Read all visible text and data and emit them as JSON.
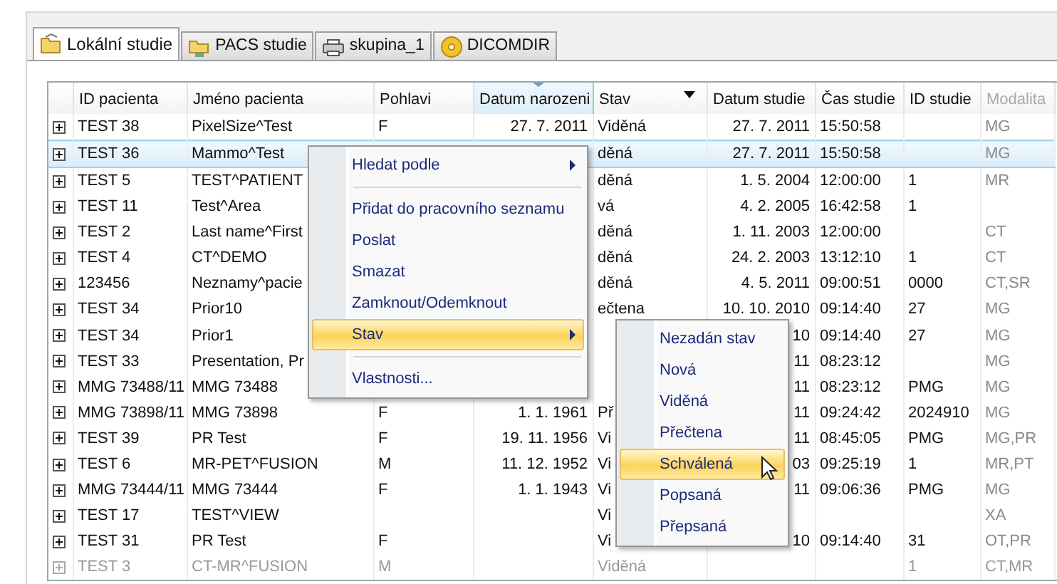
{
  "tabs": [
    {
      "label": "Lokální studie",
      "selected": true,
      "kind": "folder"
    },
    {
      "label": "PACS studie",
      "selected": false,
      "kind": "network"
    },
    {
      "label": "skupina_1",
      "selected": false,
      "kind": "printer"
    },
    {
      "label": "DICOMDIR",
      "selected": false,
      "kind": "disc"
    }
  ],
  "table": {
    "columns": [
      {
        "label": "ID pacienta",
        "sorted": false,
        "filter": false,
        "dimmed": false
      },
      {
        "label": "Jméno pacienta",
        "sorted": false,
        "filter": false,
        "dimmed": false
      },
      {
        "label": "Pohlavi",
        "sorted": false,
        "filter": false,
        "dimmed": false
      },
      {
        "label": "Datum narozeni",
        "sorted": true,
        "filter": false,
        "dimmed": false
      },
      {
        "label": "Stav",
        "sorted": false,
        "filter": true,
        "dimmed": false
      },
      {
        "label": "Datum studie",
        "sorted": false,
        "filter": false,
        "dimmed": false
      },
      {
        "label": "Čas studie",
        "sorted": false,
        "filter": false,
        "dimmed": false
      },
      {
        "label": "ID studie",
        "sorted": false,
        "filter": false,
        "dimmed": false
      },
      {
        "label": "Modalita",
        "sorted": false,
        "filter": false,
        "dimmed": true
      }
    ],
    "rows": [
      {
        "selected": false,
        "dimmed": false,
        "cells": [
          "TEST 38",
          "PixelSize^Test",
          "F",
          "27. 7. 2011",
          "Viděná",
          "27. 7. 2011",
          "15:50:58",
          null,
          "MG"
        ]
      },
      {
        "selected": true,
        "dimmed": false,
        "cells": [
          "TEST 36",
          "Mammo^Test",
          null,
          null,
          "děná",
          "27. 7. 2011",
          "15:50:58",
          null,
          "MG"
        ]
      },
      {
        "selected": false,
        "dimmed": false,
        "cells": [
          "TEST 5",
          "TEST^PATIENT",
          null,
          null,
          "děná",
          "1. 5. 2004",
          "12:00:00",
          "1",
          "MR"
        ]
      },
      {
        "selected": false,
        "dimmed": false,
        "cells": [
          "TEST 11",
          "Test^Area",
          null,
          null,
          "vá",
          "4. 2. 2005",
          "16:42:58",
          "1",
          null
        ]
      },
      {
        "selected": false,
        "dimmed": false,
        "cells": [
          "TEST 2",
          "Last name^First",
          null,
          null,
          "děná",
          "1. 11. 2003",
          "12:00:00",
          null,
          "CT"
        ]
      },
      {
        "selected": false,
        "dimmed": false,
        "cells": [
          "TEST 4",
          "CT^DEMO",
          null,
          null,
          "děná",
          "24. 2. 2003",
          "13:12:10",
          "1",
          "CT"
        ]
      },
      {
        "selected": false,
        "dimmed": false,
        "cells": [
          "123456",
          "Neznamy^pacie",
          null,
          null,
          "děná",
          "4. 5. 2011",
          "09:00:51",
          "0000",
          "CT,SR"
        ]
      },
      {
        "selected": false,
        "dimmed": false,
        "cells": [
          "TEST 34",
          "Prior10",
          null,
          null,
          "ečtena",
          "10. 10. 2010",
          "09:14:40",
          "27",
          "MG"
        ]
      },
      {
        "selected": false,
        "dimmed": false,
        "cells": [
          "TEST 34",
          "Prior1",
          null,
          null,
          null,
          "10",
          "09:14:40",
          "27",
          "MG"
        ]
      },
      {
        "selected": false,
        "dimmed": false,
        "cells": [
          "TEST 33",
          "Presentation, Pr",
          null,
          null,
          null,
          "11",
          "08:23:12",
          null,
          "MG"
        ]
      },
      {
        "selected": false,
        "dimmed": false,
        "cells": [
          "MMG 73488/11",
          "MMG 73488",
          null,
          null,
          null,
          "11",
          "08:23:12",
          "PMG",
          "MG"
        ]
      },
      {
        "selected": false,
        "dimmed": false,
        "cells": [
          "MMG 73898/11",
          "MMG 73898",
          "F",
          "1. 1. 1961",
          "Př",
          "11",
          "09:24:42",
          "2024910",
          "MG"
        ]
      },
      {
        "selected": false,
        "dimmed": false,
        "cells": [
          "TEST 39",
          "PR Test",
          "F",
          "19. 11. 1956",
          "Vi",
          "11",
          "08:45:05",
          "PMG",
          "MG,PR"
        ]
      },
      {
        "selected": false,
        "dimmed": false,
        "cells": [
          "TEST 6",
          "MR-PET^FUSION",
          "M",
          "11. 12. 1952",
          "Vi",
          "03",
          "09:25:19",
          "1",
          "MR,PT"
        ]
      },
      {
        "selected": false,
        "dimmed": false,
        "cells": [
          "MMG 73444/11",
          "MMG 73444",
          "F",
          "1. 1. 1943",
          "Vi",
          "11",
          "09:06:36",
          "PMG",
          "MG"
        ]
      },
      {
        "selected": false,
        "dimmed": false,
        "cells": [
          "TEST 17",
          "TEST^VIEW",
          null,
          null,
          "Vi",
          null,
          null,
          null,
          "XA"
        ]
      },
      {
        "selected": false,
        "dimmed": false,
        "cells": [
          "TEST 31",
          "PR Test",
          "F",
          null,
          "Vi",
          "10",
          "09:14:40",
          "31",
          "OT,PR"
        ]
      },
      {
        "selected": false,
        "dimmed": true,
        "cells": [
          "TEST 3",
          "CT-MR^FUSION",
          "M",
          null,
          "Viděná",
          null,
          null,
          "1",
          "CT,MR"
        ]
      }
    ]
  },
  "context_menu": {
    "items": [
      {
        "kind": "submenu",
        "label": "Hledat podle",
        "selected": false
      },
      {
        "kind": "separator"
      },
      {
        "kind": "item",
        "label": "Přidat do pracovního seznamu",
        "selected": false
      },
      {
        "kind": "item",
        "label": "Poslat",
        "selected": false
      },
      {
        "kind": "item",
        "label": "Smazat",
        "selected": false
      },
      {
        "kind": "item",
        "label": "Zamknout/Odemknout",
        "selected": false
      },
      {
        "kind": "submenu",
        "label": "Stav",
        "selected": true
      },
      {
        "kind": "separator"
      },
      {
        "kind": "item",
        "label": "Vlastnosti...",
        "selected": false
      }
    ]
  },
  "submenu": {
    "items": [
      {
        "kind": "item",
        "label": "Nezadán stav",
        "selected": false
      },
      {
        "kind": "item",
        "label": "Nová",
        "selected": false
      },
      {
        "kind": "item",
        "label": "Viděná",
        "selected": false
      },
      {
        "kind": "item",
        "label": "Přečtena",
        "selected": false
      },
      {
        "kind": "item",
        "label": "Schválená",
        "selected": true
      },
      {
        "kind": "item",
        "label": "Popsaná",
        "selected": false
      },
      {
        "kind": "item",
        "label": "Přepsaná",
        "selected": false
      }
    ]
  }
}
